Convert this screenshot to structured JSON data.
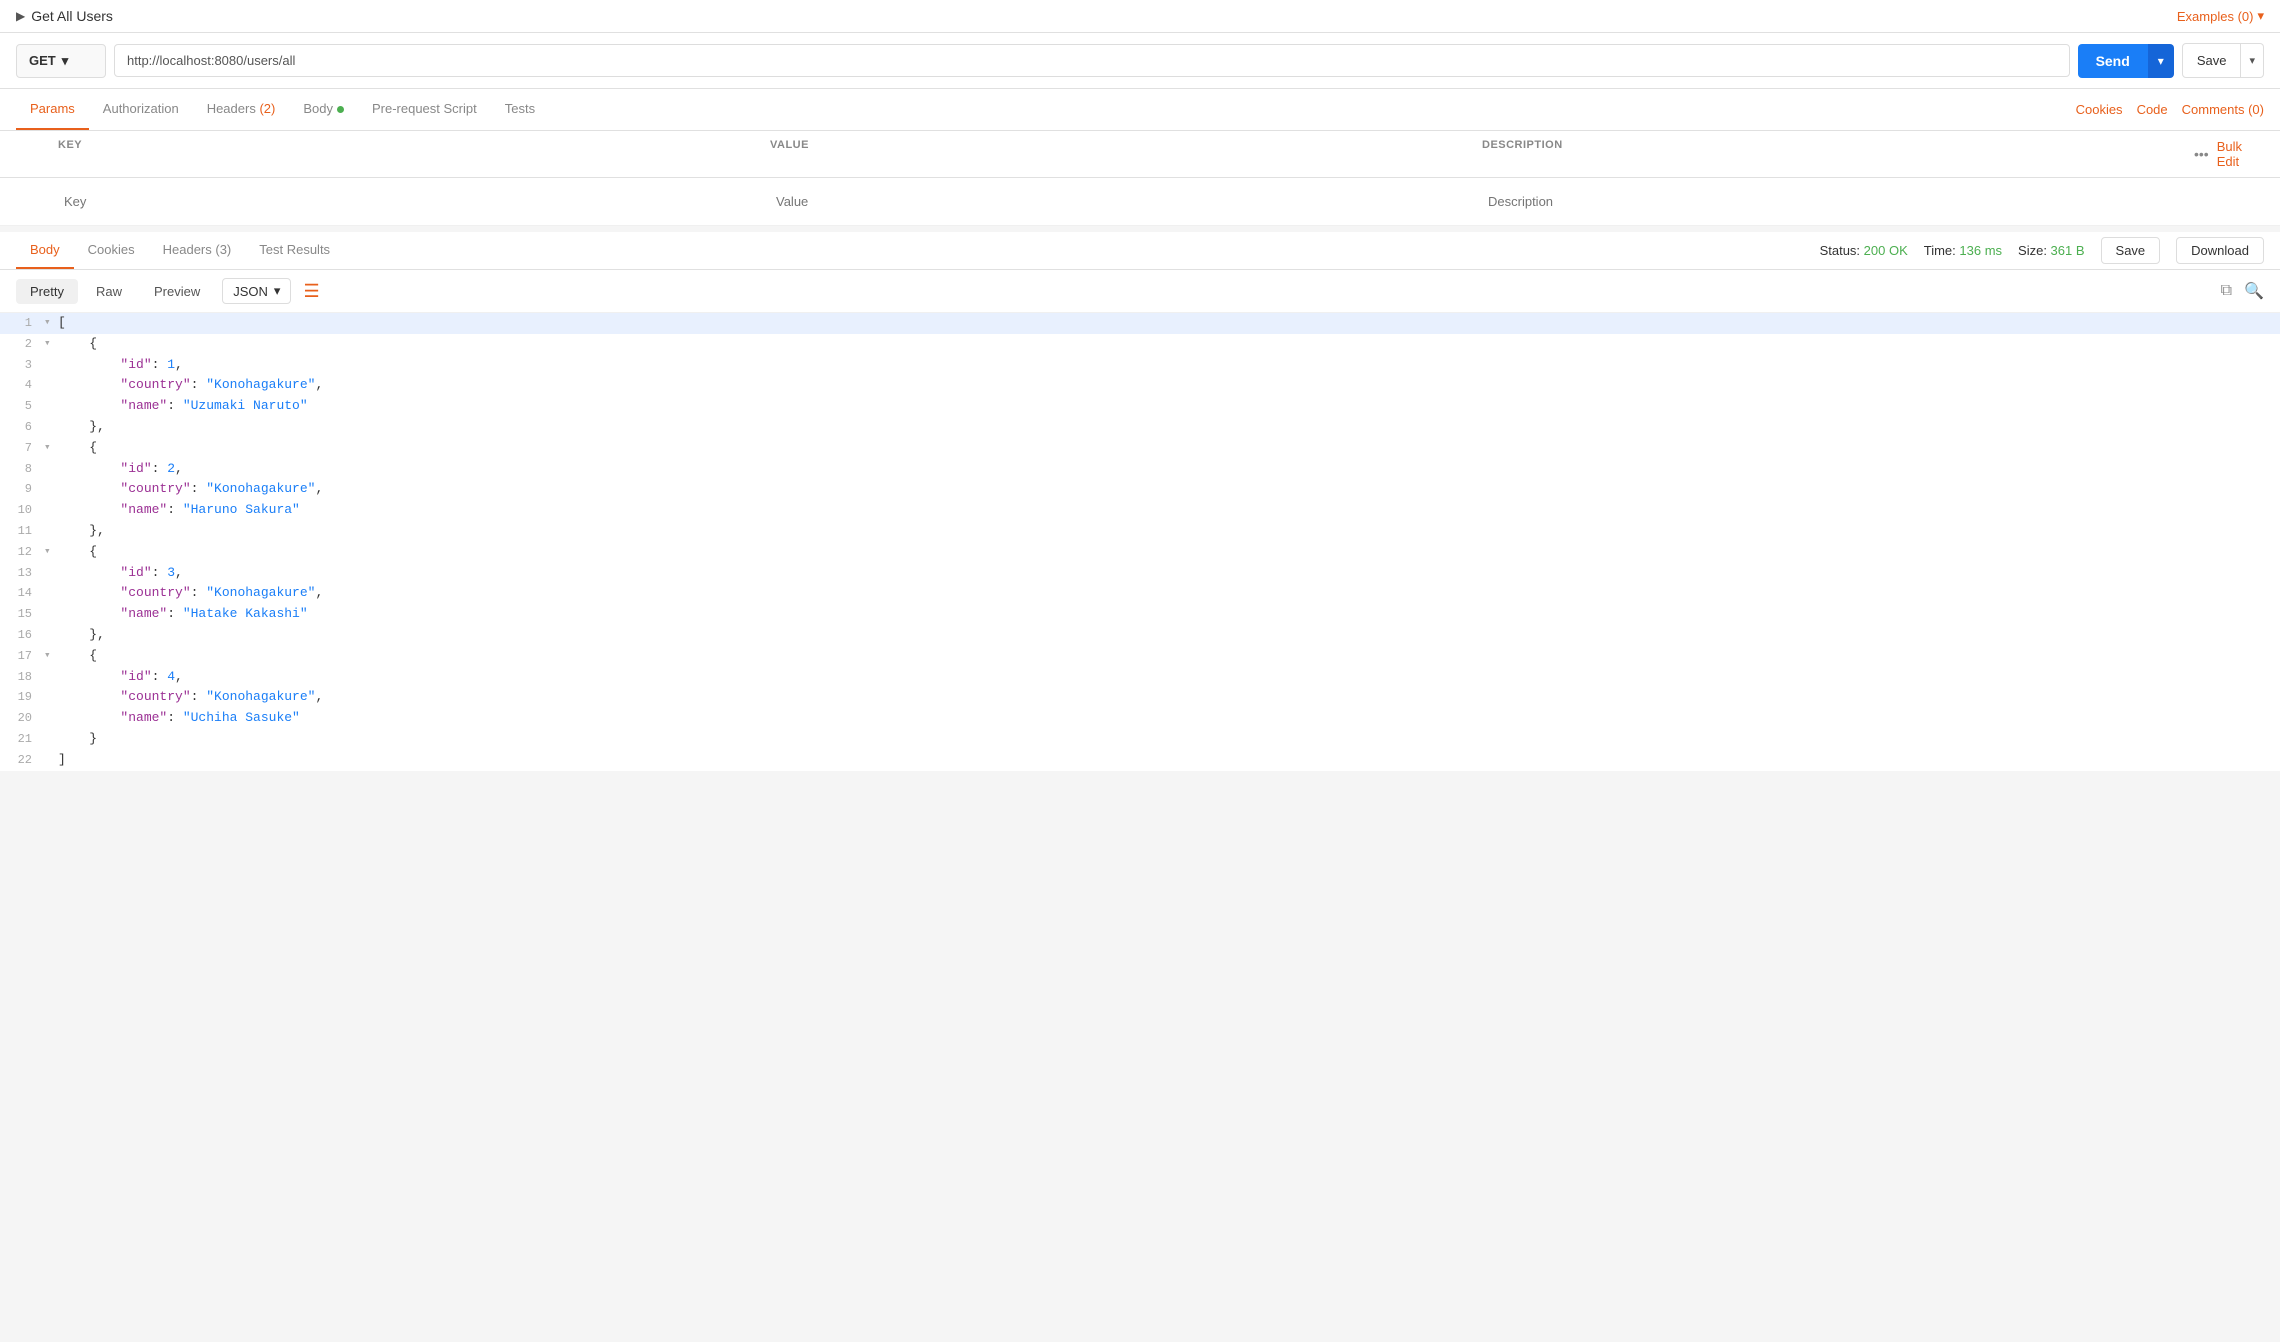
{
  "topBar": {
    "requestName": "Get All Users",
    "examplesLabel": "Examples (0)",
    "chevronIcon": "▶"
  },
  "urlBar": {
    "method": "GET",
    "url": "http://localhost:8080/users/all",
    "sendLabel": "Send",
    "saveLabel": "Save"
  },
  "requestTabs": {
    "tabs": [
      {
        "id": "params",
        "label": "Params",
        "active": true
      },
      {
        "id": "authorization",
        "label": "Authorization",
        "active": false
      },
      {
        "id": "headers",
        "label": "Headers",
        "badge": "(2)",
        "active": false
      },
      {
        "id": "body",
        "label": "Body",
        "hasDot": true,
        "active": false
      },
      {
        "id": "prerequest",
        "label": "Pre-request Script",
        "active": false
      },
      {
        "id": "tests",
        "label": "Tests",
        "active": false
      }
    ],
    "rightLinks": [
      "Cookies",
      "Code",
      "Comments (0)"
    ]
  },
  "paramsTable": {
    "columns": [
      "KEY",
      "VALUE",
      "DESCRIPTION"
    ],
    "keyPlaceholder": "Key",
    "valuePlaceholder": "Value",
    "descPlaceholder": "Description",
    "bulkEditLabel": "Bulk Edit"
  },
  "responseTabs": {
    "tabs": [
      {
        "id": "body",
        "label": "Body",
        "active": true
      },
      {
        "id": "cookies",
        "label": "Cookies",
        "active": false
      },
      {
        "id": "headers",
        "label": "Headers",
        "badge": "(3)",
        "active": false
      },
      {
        "id": "testresults",
        "label": "Test Results",
        "active": false
      }
    ],
    "status": {
      "label": "Status:",
      "value": "200 OK",
      "timeLabel": "Time:",
      "timeValue": "136 ms",
      "sizeLabel": "Size:",
      "sizeValue": "361 B"
    },
    "saveBtn": "Save",
    "downloadBtn": "Download"
  },
  "bodyFormatBar": {
    "tabs": [
      {
        "id": "pretty",
        "label": "Pretty",
        "active": true
      },
      {
        "id": "raw",
        "label": "Raw",
        "active": false
      },
      {
        "id": "preview",
        "label": "Preview",
        "active": false
      }
    ],
    "formatSelect": "JSON"
  },
  "codeLines": [
    {
      "num": 1,
      "arrow": "▾",
      "content": "[",
      "highlighted": true
    },
    {
      "num": 2,
      "arrow": "▾",
      "content": "    {",
      "highlighted": false
    },
    {
      "num": 3,
      "arrow": "",
      "content": "        \"id\": 1,",
      "highlighted": false
    },
    {
      "num": 4,
      "arrow": "",
      "content": "        \"country\": \"Konohagakure\",",
      "highlighted": false
    },
    {
      "num": 5,
      "arrow": "",
      "content": "        \"name\": \"Uzumaki Naruto\"",
      "highlighted": false
    },
    {
      "num": 6,
      "arrow": "",
      "content": "    },",
      "highlighted": false
    },
    {
      "num": 7,
      "arrow": "▾",
      "content": "    {",
      "highlighted": false
    },
    {
      "num": 8,
      "arrow": "",
      "content": "        \"id\": 2,",
      "highlighted": false
    },
    {
      "num": 9,
      "arrow": "",
      "content": "        \"country\": \"Konohagakure\",",
      "highlighted": false
    },
    {
      "num": 10,
      "arrow": "",
      "content": "        \"name\": \"Haruno Sakura\"",
      "highlighted": false
    },
    {
      "num": 11,
      "arrow": "",
      "content": "    },",
      "highlighted": false
    },
    {
      "num": 12,
      "arrow": "▾",
      "content": "    {",
      "highlighted": false
    },
    {
      "num": 13,
      "arrow": "",
      "content": "        \"id\": 3,",
      "highlighted": false
    },
    {
      "num": 14,
      "arrow": "",
      "content": "        \"country\": \"Konohagakure\",",
      "highlighted": false
    },
    {
      "num": 15,
      "arrow": "",
      "content": "        \"name\": \"Hatake Kakashi\"",
      "highlighted": false
    },
    {
      "num": 16,
      "arrow": "",
      "content": "    },",
      "highlighted": false
    },
    {
      "num": 17,
      "arrow": "▾",
      "content": "    {",
      "highlighted": false
    },
    {
      "num": 18,
      "arrow": "",
      "content": "        \"id\": 4,",
      "highlighted": false
    },
    {
      "num": 19,
      "arrow": "",
      "content": "        \"country\": \"Konohagakure\",",
      "highlighted": false
    },
    {
      "num": 20,
      "arrow": "",
      "content": "        \"name\": \"Uchiha Sasuke\"",
      "highlighted": false
    },
    {
      "num": 21,
      "arrow": "",
      "content": "    }",
      "highlighted": false
    },
    {
      "num": 22,
      "arrow": "",
      "content": "]",
      "highlighted": false
    }
  ],
  "jsonData": [
    {
      "id": 1,
      "country": "Konohagakure",
      "name": "Uzumaki Naruto"
    },
    {
      "id": 2,
      "country": "Konohagakure",
      "name": "Haruno Sakura"
    },
    {
      "id": 3,
      "country": "Konohagakure",
      "name": "Hatake Kakashi"
    },
    {
      "id": 4,
      "country": "Konohagakure",
      "name": "Uchiha Sasuke"
    }
  ]
}
